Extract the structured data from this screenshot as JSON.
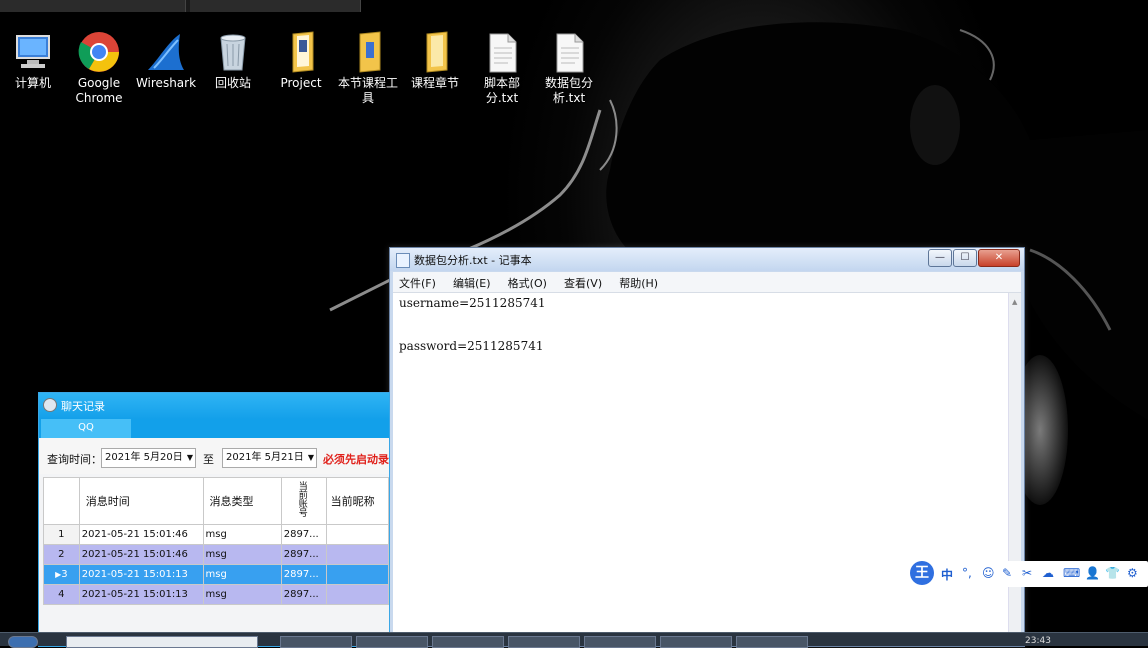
{
  "desktop": {
    "icons": [
      {
        "label": "计算机",
        "icon": "computer-icon"
      },
      {
        "label": "Google Chrome",
        "icon": "chrome-icon"
      },
      {
        "label": "Wireshark",
        "icon": "wireshark-icon"
      },
      {
        "label": "回收站",
        "icon": "recycle-bin-icon"
      },
      {
        "label": "Project",
        "icon": "folder-icon"
      },
      {
        "label": "本节课程工具",
        "icon": "folder-icon"
      },
      {
        "label": "课程章节",
        "icon": "folder-icon"
      },
      {
        "label": "脚本部分.txt",
        "icon": "text-file-icon"
      },
      {
        "label": "数据包分析.txt",
        "icon": "text-file-icon"
      }
    ]
  },
  "notepad": {
    "title": "数据包分析.txt - 记事本",
    "menu": [
      "文件(F)",
      "编辑(E)",
      "格式(O)",
      "查看(V)",
      "帮助(H)"
    ],
    "lines": [
      "username=2511285741",
      "",
      "password=2511285741"
    ],
    "buttons": {
      "minimize": "—",
      "maximize": "☐",
      "close": "✕"
    }
  },
  "chat": {
    "title": "聊天记录",
    "tab": "QQ",
    "query_label": "查询时间：",
    "from_date": "2021年 5月20日",
    "to_label": "至",
    "to_date": "2021年 5月21日",
    "warning": "必须先启动录",
    "columns": [
      "消息时间",
      "消息类型",
      "当前账号",
      "当前昵称"
    ],
    "rows": [
      {
        "num": "1",
        "time": "2021-05-21 15:01:46",
        "type": "msg",
        "account": "2897..."
      },
      {
        "num": "2",
        "time": "2021-05-21 15:01:46",
        "type": "msg",
        "account": "2897..."
      },
      {
        "num": "3",
        "time": "2021-05-21 15:01:13",
        "type": "msg",
        "account": "2897..."
      },
      {
        "num": "4",
        "time": "2021-05-21 15:01:13",
        "type": "msg",
        "account": "2897..."
      }
    ],
    "selected_row": 3
  },
  "ime": {
    "logo": "王",
    "mode": "中"
  },
  "taskbar": {
    "clock": "23:43"
  },
  "colors": {
    "accent": "#13a0ea",
    "selection": "#38a0f0",
    "alt_row": "#b8b8f0",
    "warning": "#e0201a"
  }
}
